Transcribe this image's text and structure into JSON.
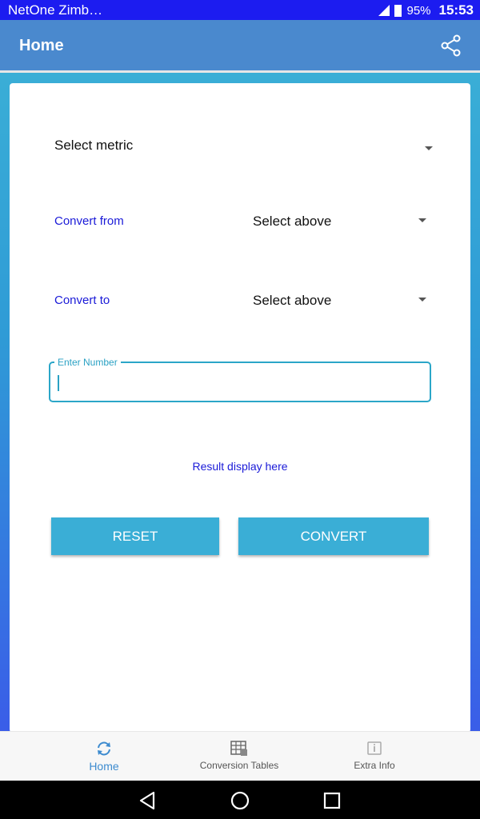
{
  "status_bar": {
    "carrier": "NetOne Zimb…",
    "battery": "95%",
    "time": "15:53"
  },
  "app_bar": {
    "title": "Home",
    "share_icon": "share-icon"
  },
  "form": {
    "metric_label": "Select metric",
    "from_label": "Convert from",
    "from_value": "Select above",
    "to_label": "Convert to",
    "to_value": "Select above",
    "number_label": "Enter Number",
    "number_value": "",
    "result_text": "Result display here",
    "reset_label": "RESET",
    "convert_label": "CONVERT"
  },
  "bottom_nav": {
    "items": [
      {
        "label": "Home",
        "icon": "refresh-icon",
        "active": true
      },
      {
        "label": "Conversion Tables",
        "icon": "table-icon",
        "active": false
      },
      {
        "label": "Extra Info",
        "icon": "info-icon",
        "active": false
      }
    ]
  },
  "colors": {
    "accent": "#3aaed6",
    "app_bar": "#4a89ce",
    "status_bar": "#1c1cf0",
    "label_blue": "#1a1ad8"
  }
}
